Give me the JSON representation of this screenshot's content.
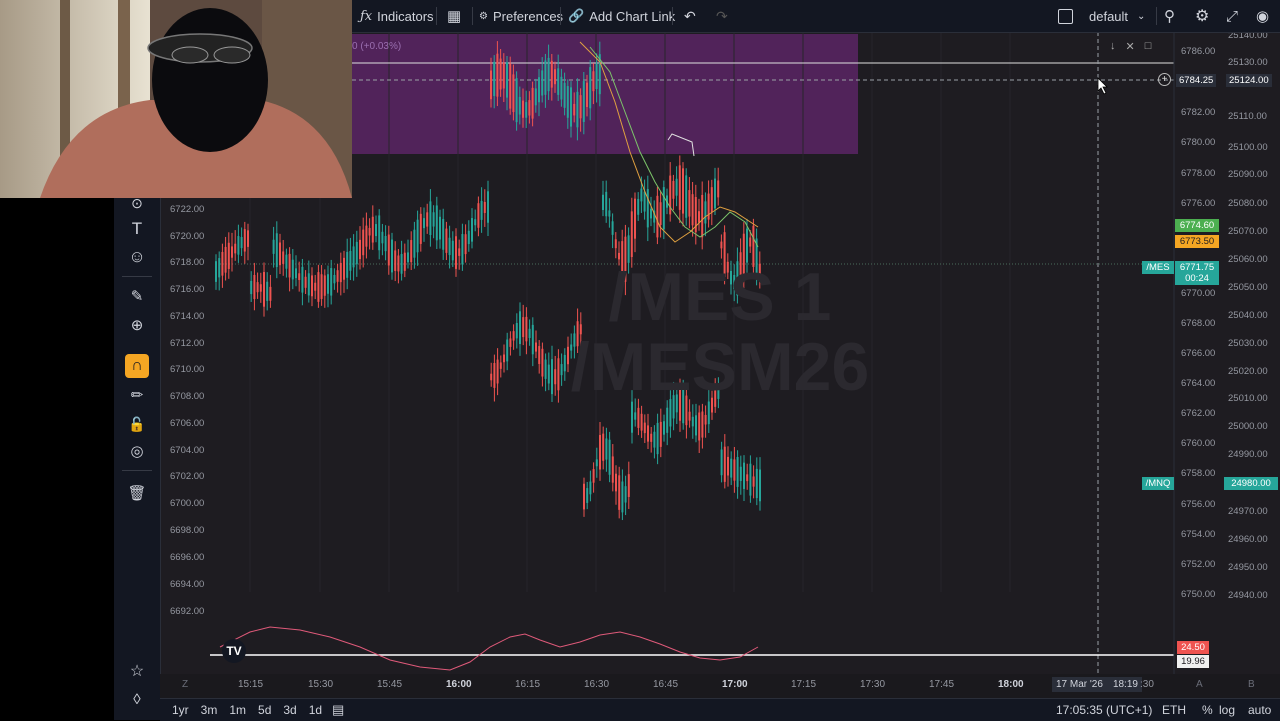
{
  "toolbar": {
    "indicators": "Indicators",
    "preferences": "Preferences",
    "add_chart_link": "Add Chart Link",
    "layout": "default"
  },
  "watermark": {
    "line1": "/MES 1",
    "line2": "/MESM26"
  },
  "overlay_text": "0 (+0.03%)",
  "left_axis": {
    "ticks": [
      "6722.00",
      "6720.00",
      "6718.00",
      "6716.00",
      "6714.00",
      "6712.00",
      "6710.00",
      "6708.00",
      "6706.00",
      "6704.00",
      "6702.00",
      "6700.00",
      "6698.00",
      "6696.00",
      "6694.00",
      "6692.00"
    ]
  },
  "price_axis_1": {
    "ticks": [
      "6786.00",
      "6782.00",
      "6780.00",
      "6778.00",
      "6776.00",
      "6770.00",
      "6768.00",
      "6766.00",
      "6764.00",
      "6762.00",
      "6760.00",
      "6758.00",
      "6756.00",
      "6754.00",
      "6752.00",
      "6750.00"
    ],
    "crosshair": "6784.25",
    "labels": {
      "green": "6774.60",
      "orange": "6773.50",
      "last_price": "6771.75",
      "countdown": "00:24"
    }
  },
  "price_axis_2": {
    "ticks": [
      "25140.00",
      "25130.00",
      "25110.00",
      "25100.00",
      "25090.00",
      "25080.00",
      "25070.00",
      "25060.00",
      "25050.00",
      "25040.00",
      "25030.00",
      "25020.00",
      "25010.00",
      "25000.00",
      "24990.00",
      "24970.00",
      "24960.00",
      "24950.00",
      "24940.00"
    ],
    "crosshair": "25124.00",
    "last_price": "24980.00"
  },
  "symbols": {
    "mes": "/MES",
    "mnq": "/MNQ"
  },
  "oscillator": {
    "red": "24.50",
    "white": "19.96"
  },
  "time_axis": {
    "labels": [
      "15:15",
      "15:30",
      "15:45",
      "16:00",
      "16:15",
      "16:30",
      "16:45",
      "17:00",
      "17:15",
      "17:30",
      "17:45",
      "18:00"
    ],
    "crosshair": "17 Mar '26",
    "crosshair_time": "18:19",
    "partial": ":30",
    "left_letter": "Z",
    "a": "A",
    "b": "B"
  },
  "bottombar": {
    "ranges": [
      "1yr",
      "3m",
      "1m",
      "5d",
      "3d",
      "1d"
    ],
    "clock": "17:05:35 (UTC+1)",
    "session": "ETH",
    "percent": "%",
    "log": "log",
    "auto": "auto"
  },
  "colors": {
    "up": "#26a69a",
    "down": "#ef5350",
    "zone": "#7b2a8a",
    "bg": "#1e1c21",
    "accent": "#f5a623"
  }
}
